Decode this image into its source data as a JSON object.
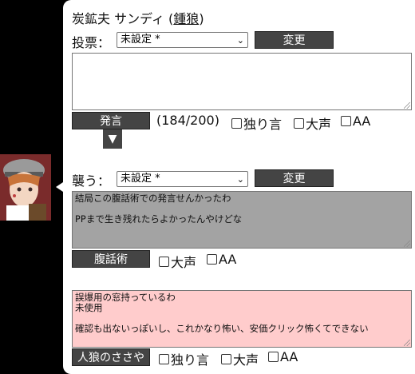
{
  "title": {
    "name": "炭鉱夫 サンディ",
    "paren_open": " (",
    "role": "鍾狼",
    "paren_close": ")"
  },
  "vote": {
    "label": "投票：",
    "selected": "未設定 *",
    "button": "変更"
  },
  "speech": {
    "text": "",
    "button": "発言",
    "counter": "(184/200)",
    "options": [
      "独り言",
      "大声",
      "AA"
    ],
    "down_icon": "▼"
  },
  "attack": {
    "label": "襲う：",
    "selected": "未設定 *",
    "button": "変更"
  },
  "ventriloquism": {
    "text": "結局この腹話術での発言せんかったわ\n\nPPまで生き残れたらよかったんやけどな",
    "button": "腹話術",
    "options": [
      "大声",
      "AA"
    ]
  },
  "whisper": {
    "text": "誤爆用の窓持っているわ\n未使用\n\n確認も出ないっぽいし、これかなり怖い、安価クリック怖くてできない",
    "button": "人狼のささや",
    "options": [
      "独り言",
      "大声",
      "AA"
    ]
  },
  "colors": {
    "dark_button": "#444444",
    "gray_area": "#a3a3a3",
    "pink_area": "#ffcccc"
  }
}
